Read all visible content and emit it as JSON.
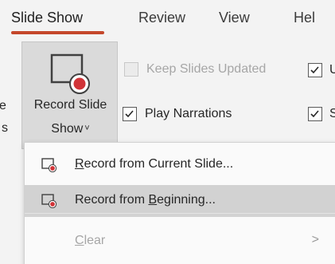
{
  "tabs": [
    {
      "label": "Slide Show",
      "active": true
    },
    {
      "label": "Review"
    },
    {
      "label": "View"
    },
    {
      "label": "Hel"
    }
  ],
  "ribbon": {
    "left_partial_1": "e",
    "left_partial_2": "s",
    "record_button": {
      "label_line_1": "Record Slide",
      "label_line_2": "Show",
      "chevron": "˅",
      "icon": "record-slide-icon"
    },
    "checkboxes": [
      {
        "label": "Keep Slides Updated",
        "checked": false,
        "disabled": true
      },
      {
        "label": "Play Narrations",
        "checked": true,
        "disabled": false
      }
    ],
    "right_partial_checkboxes": [
      {
        "label": "U",
        "checked": true
      },
      {
        "label": "S",
        "checked": true
      }
    ]
  },
  "menu": {
    "items": [
      {
        "pre": "",
        "accel": "R",
        "post": "ecord from Current Slide...",
        "icon": "record-slide-icon",
        "hover": false
      },
      {
        "pre": "Record from ",
        "accel": "B",
        "post": "eginning...",
        "icon": "record-slide-icon",
        "hover": true
      },
      {
        "pre": "",
        "accel": "C",
        "post": "lear",
        "disabled": true,
        "submenu": ">"
      }
    ]
  },
  "colors": {
    "accent": "#c4472b",
    "record_red": "#d13438"
  }
}
